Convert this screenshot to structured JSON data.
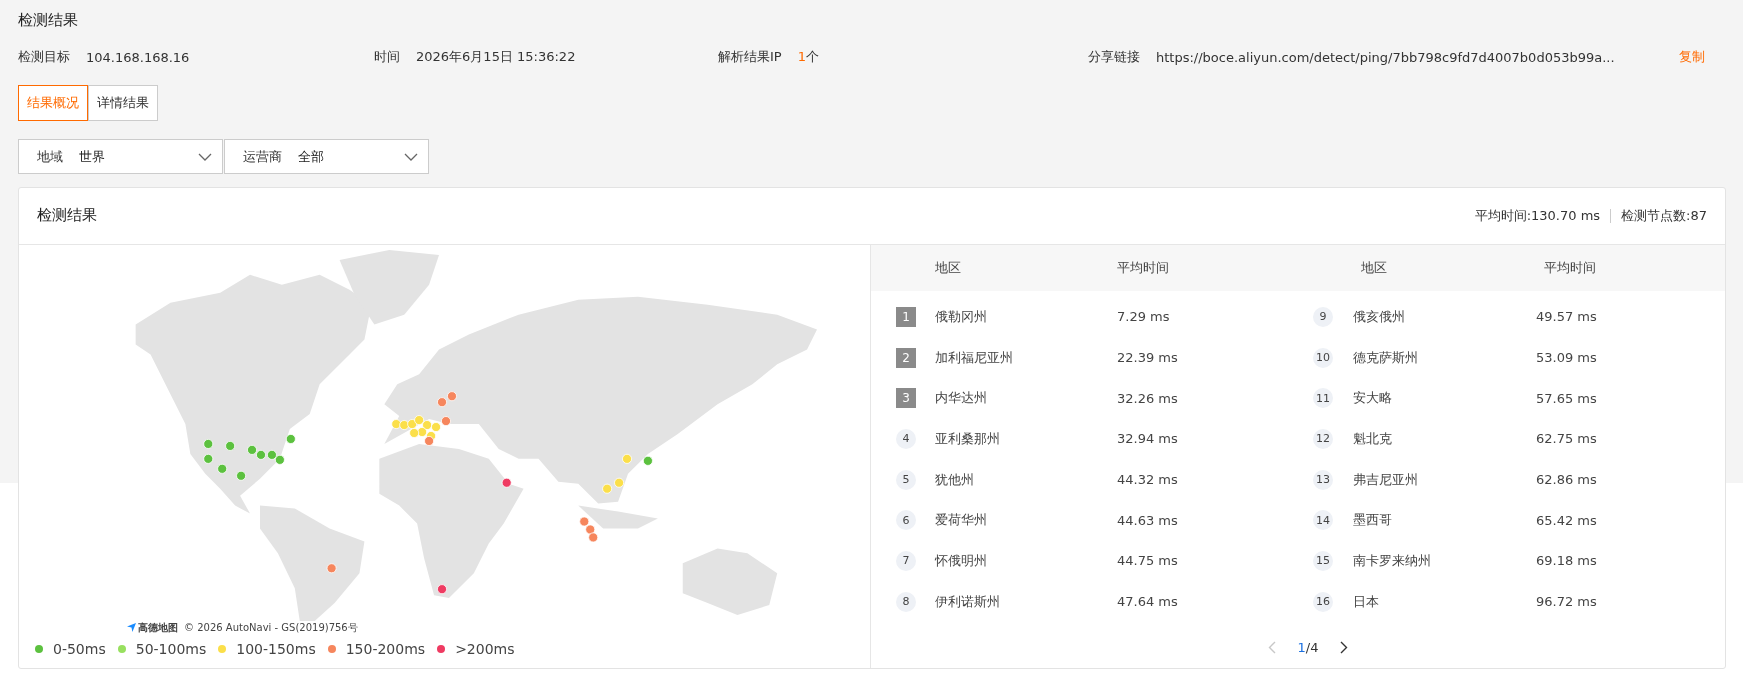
{
  "page_title": "检测结果",
  "info": [
    {
      "label": "检测目标",
      "value": "104.168.168.16"
    },
    {
      "label": "时间",
      "value": "2026年6月15日 15:36:22"
    },
    {
      "label": "解析结果IP",
      "count": "1",
      "unit": "个"
    },
    {
      "label": "分享链接",
      "value": "https://boce.aliyun.com/detect/ping/7bb798c9fd7d4007b0d053b99a...",
      "action": "复制"
    }
  ],
  "tabs": [
    {
      "label": "结果概况",
      "selected": true
    },
    {
      "label": "详情结果",
      "selected": false
    }
  ],
  "filters": [
    {
      "label": "地域",
      "value": "世界"
    },
    {
      "label": "运营商",
      "value": "全部"
    }
  ],
  "card": {
    "title": "检测结果",
    "avg_time": "平均时间:130.70 ms",
    "node_count": "检测节点数:87",
    "map": {
      "logo": "高德地图",
      "attribution": "© 2026 AutoNavi - GS(2019)756号"
    },
    "legend": [
      {
        "label": "0-50ms",
        "color": "#5cc13f"
      },
      {
        "label": "50-100ms",
        "color": "#98e05f"
      },
      {
        "label": "100-150ms",
        "color": "#fbdf4a"
      },
      {
        "label": "150-200ms",
        "color": "#f6865d"
      },
      {
        "label": ">200ms",
        "color": "#ef3b62"
      }
    ],
    "table": {
      "columns": [
        "地区",
        "平均时间",
        "地区",
        "平均时间"
      ],
      "rows": [
        {
          "rank": "1",
          "kind": "top",
          "region": "俄勒冈州",
          "time": "7.29 ms"
        },
        {
          "rank": "2",
          "kind": "top",
          "region": "加利福尼亚州",
          "time": "22.39 ms"
        },
        {
          "rank": "3",
          "kind": "top",
          "region": "内华达州",
          "time": "32.26 ms"
        },
        {
          "rank": "4",
          "kind": "normal",
          "region": "亚利桑那州",
          "time": "32.94 ms"
        },
        {
          "rank": "5",
          "kind": "normal",
          "region": "犹他州",
          "time": "44.32 ms"
        },
        {
          "rank": "6",
          "kind": "normal",
          "region": "爱荷华州",
          "time": "44.63 ms"
        },
        {
          "rank": "7",
          "kind": "normal",
          "region": "怀俄明州",
          "time": "44.75 ms"
        },
        {
          "rank": "8",
          "kind": "normal",
          "region": "伊利诺斯州",
          "time": "47.64 ms"
        },
        {
          "rank": "9",
          "kind": "normal",
          "region": "俄亥俄州",
          "time": "49.57 ms"
        },
        {
          "rank": "10",
          "kind": "normal",
          "region": "德克萨斯州",
          "time": "53.09 ms"
        },
        {
          "rank": "11",
          "kind": "normal",
          "region": "安大略",
          "time": "57.65 ms"
        },
        {
          "rank": "12",
          "kind": "normal",
          "region": "魁北克",
          "time": "62.75 ms"
        },
        {
          "rank": "13",
          "kind": "normal",
          "region": "弗吉尼亚州",
          "time": "62.86 ms"
        },
        {
          "rank": "14",
          "kind": "normal",
          "region": "墨西哥",
          "time": "65.42 ms"
        },
        {
          "rank": "15",
          "kind": "normal",
          "region": "南卡罗来纳州",
          "time": "69.18 ms"
        },
        {
          "rank": "16",
          "kind": "normal",
          "region": "日本",
          "time": "96.72 ms"
        }
      ]
    },
    "pagination": {
      "current": "1",
      "total": "/4",
      "prev_disabled": true,
      "next_disabled": false
    }
  }
}
